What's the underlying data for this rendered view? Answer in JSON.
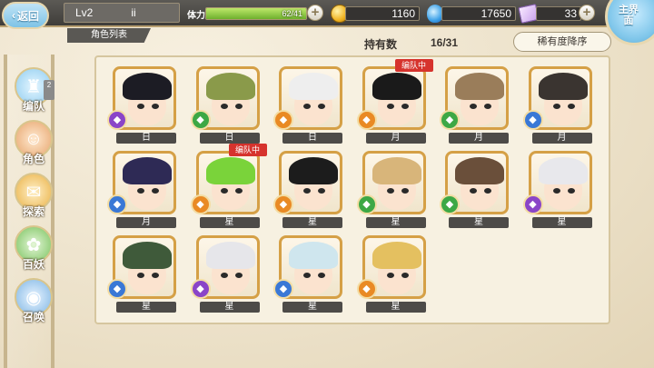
{
  "header": {
    "back_label": "返回",
    "level": "Lv2",
    "player_name": "ii",
    "stamina_label": "体力",
    "stamina_text": "62/41",
    "gold": "1160",
    "gems": "17650",
    "tickets": "33",
    "main_label": "主界面"
  },
  "list": {
    "tab_label": "角色列表",
    "own_label": "持有数",
    "own_count": "16/31",
    "sort_label": "稀有度降序"
  },
  "sidebar": {
    "items": [
      {
        "label": "编队",
        "badge": "2"
      },
      {
        "label": "角色"
      },
      {
        "label": "探索"
      },
      {
        "label": "百妖"
      },
      {
        "label": "召唤"
      }
    ]
  },
  "characters": [
    {
      "name": "日",
      "tag": "",
      "hair": "#1c1c24",
      "element": "purple"
    },
    {
      "name": "日",
      "tag": "",
      "hair": "#8a9a4a",
      "element": "green"
    },
    {
      "name": "日",
      "tag": "",
      "hair": "#eeeeee",
      "element": "orange"
    },
    {
      "name": "月",
      "tag": "编队中",
      "hair": "#1a1a1a",
      "element": "orange"
    },
    {
      "name": "月",
      "tag": "",
      "hair": "#9a7d5a",
      "element": "green"
    },
    {
      "name": "月",
      "tag": "",
      "hair": "#3a3430",
      "element": "blue"
    },
    {
      "name": "月",
      "tag": "",
      "hair": "#2e2a55",
      "element": "blue"
    },
    {
      "name": "星",
      "tag": "编队中",
      "hair": "#7ad33a",
      "element": "orange"
    },
    {
      "name": "星",
      "tag": "",
      "hair": "#1c1c1c",
      "element": "orange"
    },
    {
      "name": "星",
      "tag": "",
      "hair": "#d8b57a",
      "element": "green"
    },
    {
      "name": "星",
      "tag": "",
      "hair": "#6a4f3a",
      "element": "green"
    },
    {
      "name": "星",
      "tag": "",
      "hair": "#e8e8ec",
      "element": "purple"
    },
    {
      "name": "星",
      "tag": "",
      "hair": "#3f5a3a",
      "element": "blue"
    },
    {
      "name": "星",
      "tag": "",
      "hair": "#e6e6ea",
      "element": "purple"
    },
    {
      "name": "星",
      "tag": "",
      "hair": "#cfe6ee",
      "element": "blue"
    },
    {
      "name": "星",
      "tag": "",
      "hair": "#e4c060",
      "element": "orange"
    }
  ],
  "colors": {
    "orange": "#e98a24",
    "green": "#3da845",
    "purple": "#8a45c8",
    "blue": "#3a78d6",
    "accent": "#d6332d"
  }
}
